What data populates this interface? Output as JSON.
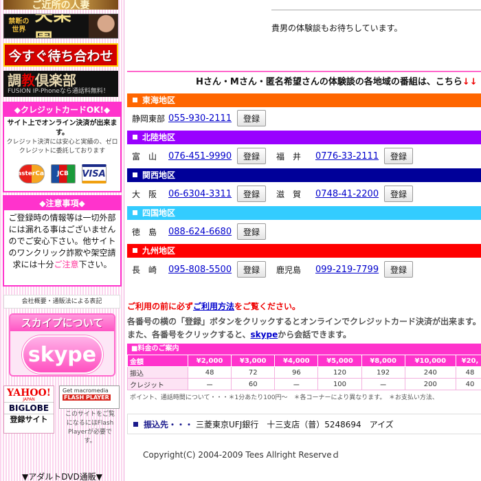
{
  "sidebar": {
    "banner1_text": "ご近所の人妻",
    "banner2": {
      "small": "禁断の世界",
      "big": "失楽園"
    },
    "banner3_text": "今すぐ待ち合わせ",
    "banner4": {
      "big_pre": "調",
      "big_accent": "教",
      "big_post": "倶楽部",
      "small": "FUSION IP-Phoneなら通話料無料！"
    },
    "credit": {
      "title": "◆クレジットカードOK!◆",
      "line1": "サイト上でオンライン決済が出来ます。",
      "line2": "クレジット決済には安心と実績の、ゼロクレジットに委託しております",
      "cards": [
        "MasterCard",
        "JCB",
        "VISA"
      ]
    },
    "notice": {
      "title": "◆注意事項◆",
      "body_pre": "ご登録時の情報等は一切外部には漏れる事はございませんのでご安心下さい。他サイトのワンクリック詐欺や架空請求には十分",
      "body_accent": "ご注意",
      "body_post": "下さい。"
    },
    "company_link": "会社概要・通販法による表記",
    "skype": {
      "heading": "スカイプについて",
      "logo": "skype"
    },
    "yahoo": {
      "name": "YAHOO!",
      "sub": "JAPAN",
      "biglobe": "BIGLOBE",
      "register": "登録サイト"
    },
    "flash": {
      "get": "Get macromedia",
      "name": "FLASH PLAYER",
      "note": "このサイトをご覧になるにはFlash Playerが必要です。"
    },
    "dvd": "▼アダルトDVD通販▼"
  },
  "main": {
    "message": "貴男の体験談もお待ちしています。",
    "header_text": "Hさん・Mさん・匿名希望さんの体験談の各地域の番組は、こちら",
    "header_arrows": "↓↓",
    "register_label": "登録",
    "regions": [
      {
        "name": "東海地区",
        "color": "#ff6600",
        "entries": [
          {
            "city": "静岡東部",
            "phone": "055-930-2111"
          }
        ]
      },
      {
        "name": "北陸地区",
        "color": "#9900ff",
        "entries": [
          {
            "city": "富　山",
            "phone": "076-451-9990"
          },
          {
            "city": "福　井",
            "phone": "0776-33-2111"
          }
        ]
      },
      {
        "name": "関西地区",
        "color": "#000099",
        "entries": [
          {
            "city": "大　阪",
            "phone": "06-6304-3311"
          },
          {
            "city": "滋　賀",
            "phone": "0748-41-2200"
          }
        ]
      },
      {
        "name": "四国地区",
        "color": "#33ccff",
        "entries": [
          {
            "city": "徳　島",
            "phone": "088-624-6680"
          }
        ]
      },
      {
        "name": "九州地区",
        "color": "#ff0000",
        "entries": [
          {
            "city": "長　崎",
            "phone": "095-808-5500"
          },
          {
            "city": "鹿児島",
            "phone": "099-219-7799"
          }
        ]
      }
    ],
    "usage_pre": "ご利用の前に必ず",
    "usage_link": "ご利用方法",
    "usage_post": "をご覧ください。",
    "instruction1": "各番号の横の「登録」ボタンをクリックするとオンラインでクレジットカード決済が出来ます。",
    "instruction2_pre": "また、各番号をクリックすると、",
    "instruction2_link": "skype",
    "instruction2_post": "から会話できます。",
    "fee": {
      "title": "■料金のご案内",
      "header": [
        "金額",
        "¥2,000",
        "¥3,000",
        "¥4,000",
        "¥5,000",
        "¥8,000",
        "¥10,000",
        "¥20,"
      ],
      "rows": [
        [
          "振込",
          "48",
          "72",
          "96",
          "120",
          "192",
          "240",
          "48"
        ],
        [
          "クレジット",
          "ー",
          "60",
          "ー",
          "100",
          "ー",
          "200",
          "40"
        ]
      ],
      "note": "ポイント、通話時間について・・・＊1分あたり100円～　＊各コーナーにより異なります。　＊お支払い方法、"
    },
    "bank": {
      "label": "振込先・・・",
      "detail": "三菱東京UFJ銀行　十三支店（普）5248694　アイズ"
    },
    "copyright": "Copyright(C) 2004-2009 Tees Allright Reserveｄ"
  }
}
